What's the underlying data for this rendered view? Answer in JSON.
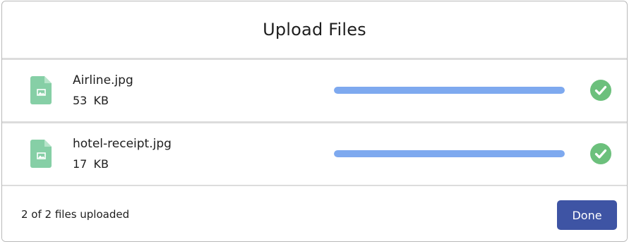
{
  "dialog": {
    "title": "Upload Files"
  },
  "files": [
    {
      "name": "Airline.jpg",
      "size": "53 KB",
      "progress_percent": 100,
      "status_icon": "check-circle-icon",
      "file_icon": "image-file-icon"
    },
    {
      "name": "hotel-receipt.jpg",
      "size": "17 KB",
      "progress_percent": 100,
      "status_icon": "check-circle-icon",
      "file_icon": "image-file-icon"
    }
  ],
  "footer": {
    "status": "2 of 2 files uploaded",
    "done_label": "Done"
  },
  "colors": {
    "progress_fill": "#7ea9ef",
    "success": "#6cc07c",
    "file_icon": "#86cfa6",
    "primary_button": "#3e54a4"
  }
}
